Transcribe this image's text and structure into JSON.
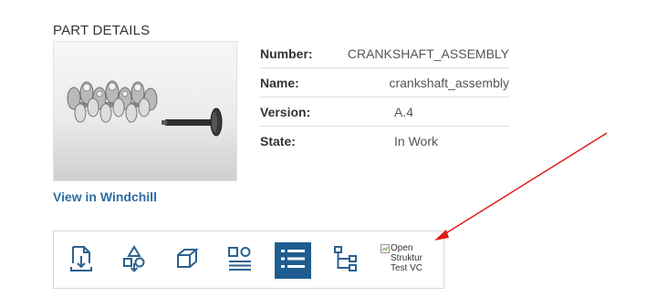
{
  "part_details": {
    "title": "PART DETAILS",
    "thumbnail_alt": "crankshaft assembly 3D thumbnail",
    "properties": [
      {
        "label": "Number:",
        "value": "CRANKSHAFT_ASSEMBLY"
      },
      {
        "label": "Name:",
        "value": "crankshaft_assembly"
      },
      {
        "label": "Version:",
        "value": "A.4"
      },
      {
        "label": "State:",
        "value": "In Work"
      }
    ],
    "view_link": "View in Windchill"
  },
  "toolbar": {
    "buttons": [
      {
        "icon": "download-document-icon",
        "active": false
      },
      {
        "icon": "shapes-download-icon",
        "active": false
      },
      {
        "icon": "cube-icon",
        "active": false
      },
      {
        "icon": "attributes-list-icon",
        "active": false
      },
      {
        "icon": "list-icon",
        "active": true
      },
      {
        "icon": "structure-tree-icon",
        "active": false
      }
    ],
    "broken_image_alt": "Open Struktur Test VC"
  },
  "colors": {
    "accent": "#1f5c8f",
    "icon": "#2b6191",
    "link": "#2d6da4",
    "annotation_arrow": "#e21b1b"
  }
}
